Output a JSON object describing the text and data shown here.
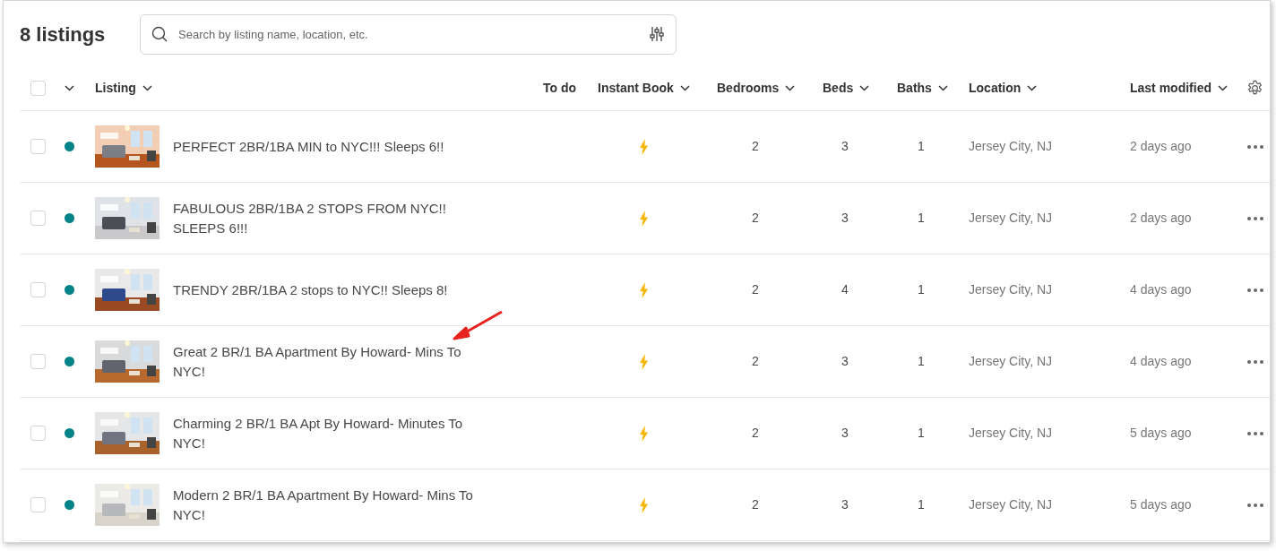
{
  "header": {
    "title": "8 listings",
    "search": {
      "placeholder": "Search by listing name, location, etc."
    }
  },
  "table": {
    "select_all": {
      "checked": false
    },
    "columns": [
      {
        "label": "Listing",
        "sortable": true
      },
      {
        "label": "To do",
        "sortable": false
      },
      {
        "label": "Instant Book",
        "sortable": true
      },
      {
        "label": "Bedrooms",
        "sortable": true
      },
      {
        "label": "Beds",
        "sortable": true
      },
      {
        "label": "Baths",
        "sortable": true
      },
      {
        "label": "Location",
        "sortable": true
      },
      {
        "label": "Last modified",
        "sortable": true
      }
    ],
    "rows": [
      {
        "checked": false,
        "listed": true,
        "title": "PERFECT 2BR/1BA MIN to NYC!!! Sleeps 6!!",
        "instant_book": true,
        "bedrooms": "2",
        "beds": "3",
        "baths": "1",
        "location": "Jersey City, NJ",
        "last_modified": "2 days ago"
      },
      {
        "checked": false,
        "listed": true,
        "title": "FABULOUS 2BR/1BA 2 STOPS FROM NYC!! SLEEPS 6!!!",
        "instant_book": true,
        "bedrooms": "2",
        "beds": "3",
        "baths": "1",
        "location": "Jersey City, NJ",
        "last_modified": "2 days ago"
      },
      {
        "checked": false,
        "listed": true,
        "title": "TRENDY 2BR/1BA 2 stops to NYC!! Sleeps 8!",
        "instant_book": true,
        "bedrooms": "2",
        "beds": "4",
        "baths": "1",
        "location": "Jersey City, NJ",
        "last_modified": "4 days ago"
      },
      {
        "checked": false,
        "listed": true,
        "title": "Great 2 BR/1 BA Apartment By Howard- Mins To NYC!",
        "instant_book": true,
        "bedrooms": "2",
        "beds": "3",
        "baths": "1",
        "location": "Jersey City, NJ",
        "last_modified": "4 days ago"
      },
      {
        "checked": false,
        "listed": true,
        "title": "Charming 2 BR/1 BA Apt By Howard- Minutes To NYC!",
        "instant_book": true,
        "bedrooms": "2",
        "beds": "3",
        "baths": "1",
        "location": "Jersey City, NJ",
        "last_modified": "5 days ago"
      },
      {
        "checked": false,
        "listed": true,
        "title": "Modern 2 BR/1 BA Apartment By Howard- Mins To NYC!",
        "instant_book": true,
        "bedrooms": "2",
        "beds": "3",
        "baths": "1",
        "location": "Jersey City, NJ",
        "last_modified": "5 days ago"
      }
    ]
  }
}
